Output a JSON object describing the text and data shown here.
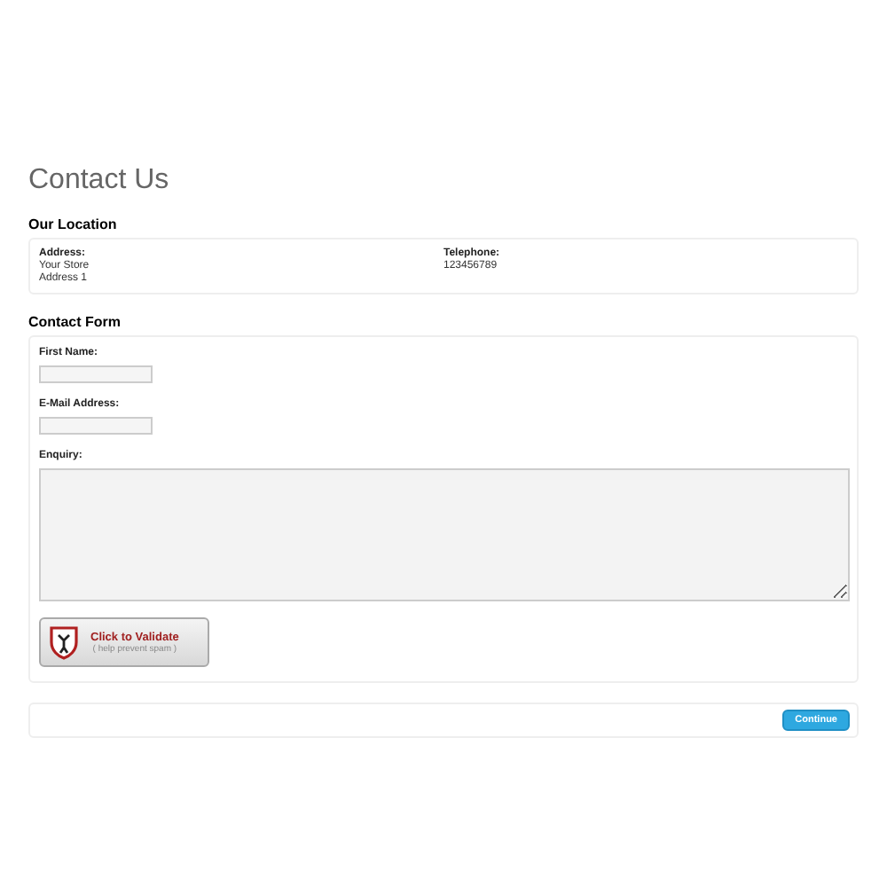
{
  "title": "Contact Us",
  "location": {
    "heading": "Our Location",
    "address_label": "Address:",
    "address_lines": [
      "Your Store",
      "Address 1"
    ],
    "telephone_label": "Telephone:",
    "telephone": "123456789"
  },
  "form": {
    "heading": "Contact Form",
    "fields": [
      {
        "label": "First Name:",
        "kind": "input"
      },
      {
        "label": "E-Mail Address:",
        "kind": "input"
      },
      {
        "label": "Enquiry:",
        "kind": "textarea"
      }
    ],
    "captcha": {
      "title": "Click to Validate",
      "subtitle": "( help prevent spam )"
    }
  },
  "buttons": {
    "continue": "Continue"
  }
}
